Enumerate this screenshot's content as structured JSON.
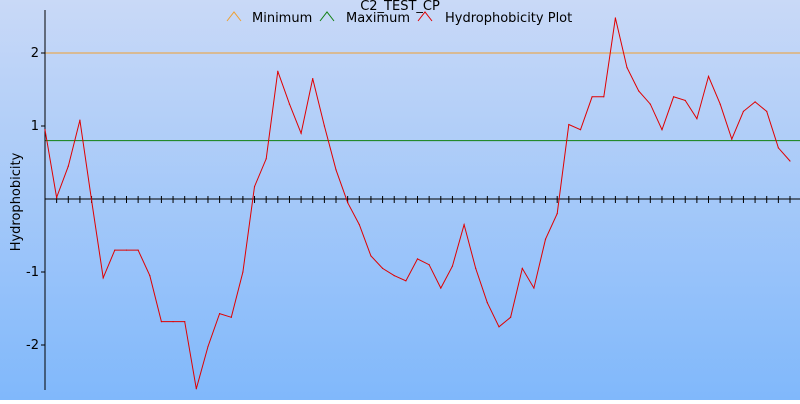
{
  "chart_data": {
    "type": "line",
    "title": "C2_TEST_CP",
    "xlabel": "",
    "ylabel": "Hydrophobicity",
    "ylim": [
      -2.6,
      2.6
    ],
    "xlim": [
      1,
      67
    ],
    "yticks": [
      2,
      1,
      -1,
      -2
    ],
    "ytick_labels": [
      "2",
      "1",
      "-1",
      "-2"
    ],
    "grid": false,
    "legend": {
      "placement": "top",
      "entries": [
        "Minimum",
        "Maximum",
        "Hydrophobicity Plot"
      ]
    },
    "colors": {
      "background_top": "#c9d9f7",
      "background_bottom": "#80b8fb",
      "minimum": "#f0a030",
      "maximum": "#108010",
      "series": "#e00000",
      "axis": "#000000"
    },
    "series": [
      {
        "name": "Minimum",
        "constant": 2.0
      },
      {
        "name": "Maximum",
        "constant": 0.8
      },
      {
        "name": "Hydrophobicity Plot",
        "values": [
          0.95,
          0.02,
          0.45,
          1.08,
          -0.02,
          -1.08,
          -0.7,
          -0.7,
          -0.7,
          -1.05,
          -1.68,
          -1.68,
          -1.68,
          -2.6,
          -2.02,
          -1.57,
          -1.62,
          -1.0,
          0.17,
          0.55,
          1.75,
          1.3,
          0.9,
          1.65,
          1.0,
          0.4,
          -0.05,
          -0.35,
          -0.78,
          -0.95,
          -1.05,
          -1.12,
          -0.82,
          -0.9,
          -1.22,
          -0.92,
          -0.35,
          -0.95,
          -1.42,
          -1.75,
          -1.62,
          -0.95,
          -1.22,
          -0.55,
          -0.2,
          1.02,
          0.95,
          1.4,
          1.4,
          2.48,
          1.8,
          1.48,
          1.3,
          0.95,
          1.4,
          1.35,
          1.1,
          1.68,
          1.3,
          0.82,
          1.2,
          1.33,
          1.2,
          0.7,
          0.52
        ]
      }
    ]
  }
}
